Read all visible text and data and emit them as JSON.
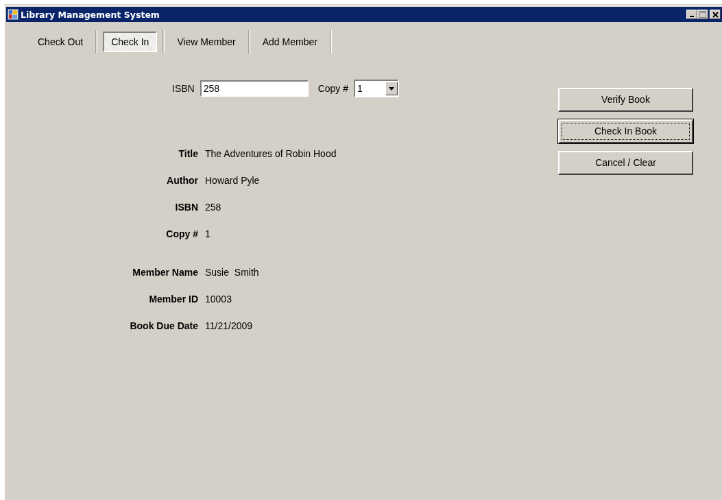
{
  "window": {
    "title": "Library Management System"
  },
  "tabs": [
    {
      "label": "Check Out",
      "selected": false
    },
    {
      "label": "Check In",
      "selected": true
    },
    {
      "label": "View Member",
      "selected": false
    },
    {
      "label": "Add Member",
      "selected": false
    }
  ],
  "isbn_field": {
    "label": "ISBN",
    "value": "258"
  },
  "copy_field": {
    "label": "Copy #",
    "value": "1"
  },
  "buttons": [
    {
      "label": "Verify Book",
      "focused": false
    },
    {
      "label": "Check In Book",
      "focused": true
    },
    {
      "label": "Cancel / Clear",
      "focused": false
    }
  ],
  "detail_groups": [
    [
      {
        "label": "Title",
        "value": "The Adventures of Robin Hood"
      },
      {
        "label": "Author",
        "value": "Howard Pyle"
      },
      {
        "label": "ISBN",
        "value": "258"
      },
      {
        "label": "Copy #",
        "value": "1"
      }
    ],
    [
      {
        "label": "Member Name",
        "value": "Susie  Smith"
      },
      {
        "label": "Member ID",
        "value": "10003"
      },
      {
        "label": "Book Due Date",
        "value": "11/21/2009"
      }
    ]
  ]
}
